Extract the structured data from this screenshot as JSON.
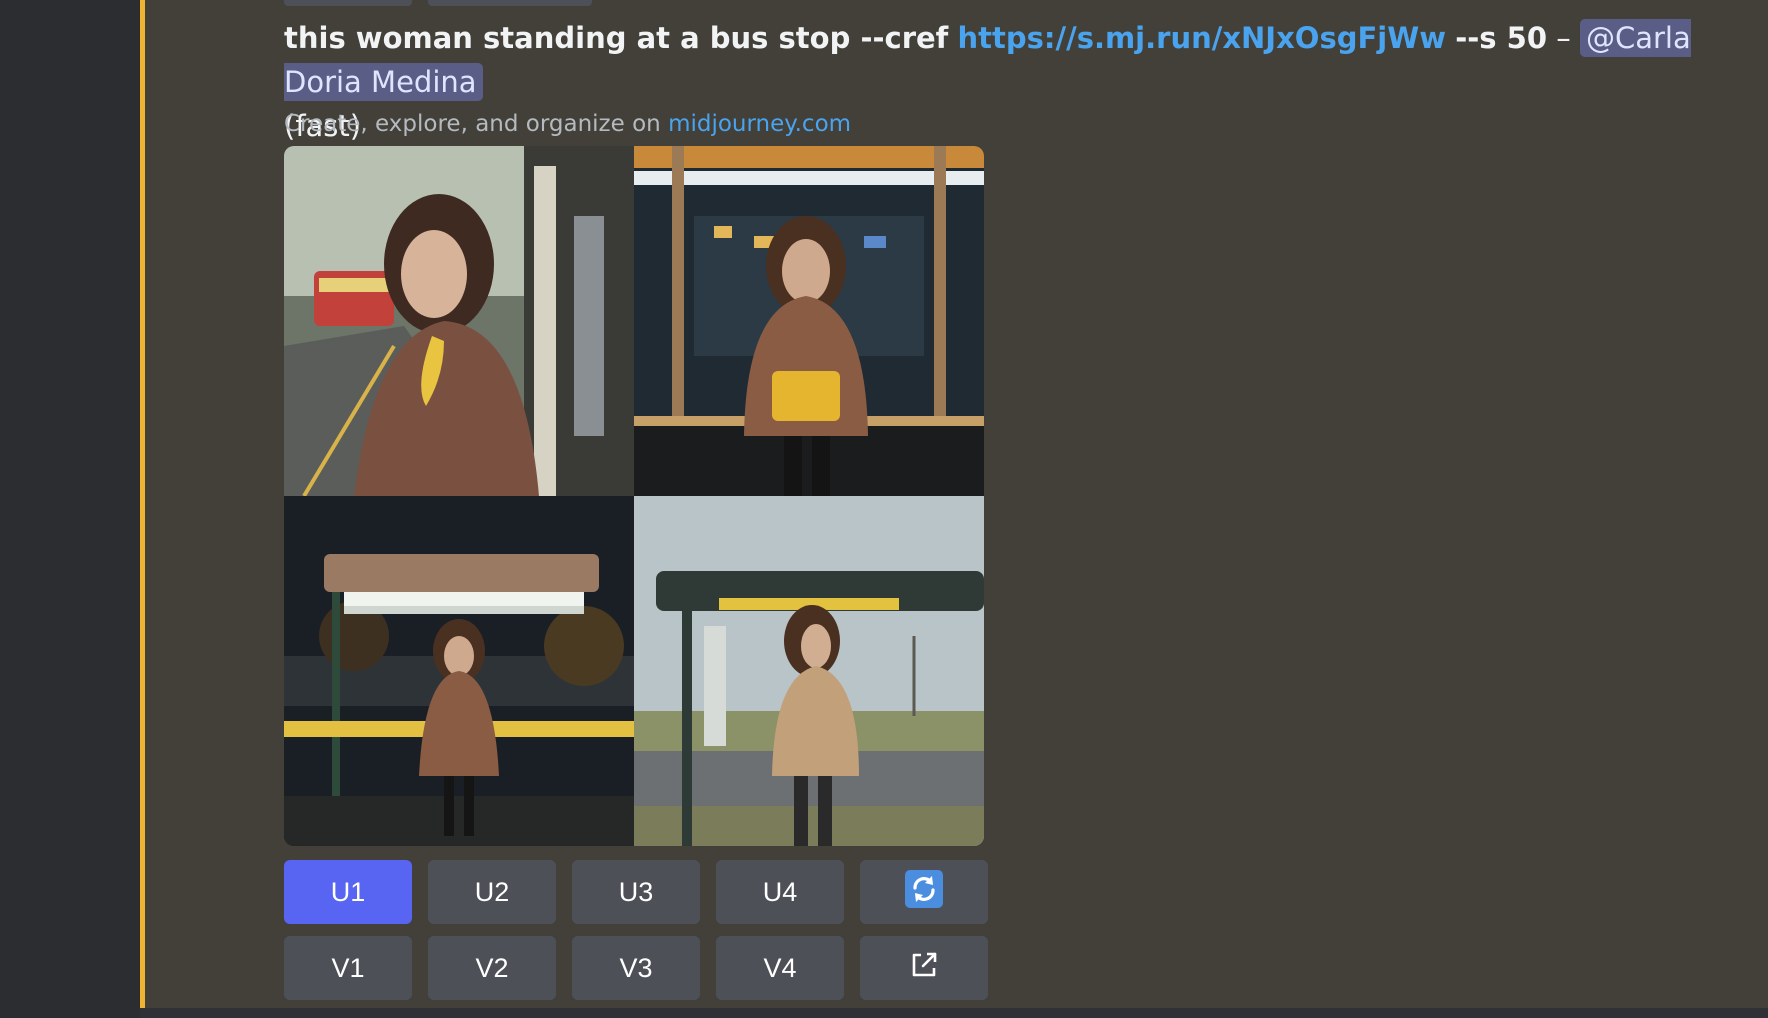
{
  "message": {
    "prompt_text": "this woman standing at a bus stop --cref",
    "link_text": "https://s.mj.run/xNJxOsgFjWw",
    "params_text": "--s 50",
    "separator": "–",
    "mention": "@Carla Doria Medina",
    "mode": "(fast)",
    "subtext_prefix": "Create, explore, and organize on",
    "subtext_link": "midjourney.com"
  },
  "buttons": {
    "row1": [
      "U1",
      "U2",
      "U3",
      "U4"
    ],
    "row2": [
      "V1",
      "V2",
      "V3",
      "V4"
    ],
    "reroll_icon": "reroll-icon",
    "open_icon": "external-link-icon"
  },
  "colors": {
    "primary_button": "#5865f2",
    "secondary_button": "#4e5058",
    "link": "#4aa3ee",
    "highlight_bar": "#f0b232",
    "background": "#424038"
  }
}
